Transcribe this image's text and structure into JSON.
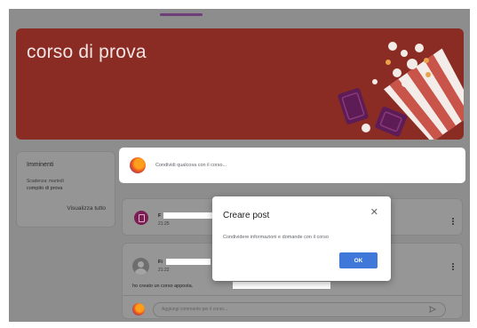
{
  "banner": {
    "course_title": "corso di prova"
  },
  "upcoming": {
    "title": "Imminenti",
    "due": "Scadenza: martedì",
    "item": "compito di prova",
    "view_all": "Visualizza tutto"
  },
  "stream": {
    "share_placeholder": "Condividi qualcosa con il corso...",
    "assignment": {
      "title_visible": "F",
      "time": "21:25"
    },
    "post": {
      "author_visible": "Fi",
      "time": "21:22",
      "body": "ho creato un corso apposta."
    },
    "comment_placeholder": "Aggiungi commento per il corso..."
  },
  "dialog": {
    "title": "Creare post",
    "text": "Condividere informazioni e domande con il corso",
    "close_icon": "close-icon",
    "ok_label": "OK"
  },
  "colors": {
    "banner": "#8b2c24",
    "accent": "#3f78d9",
    "assignment_icon": "#7b1c52"
  },
  "icons": [
    "popcorn-illustration",
    "firefox-avatar-icon",
    "assignment-icon",
    "user-avatar-icon",
    "more-vert-icon",
    "send-icon",
    "close-icon"
  ]
}
